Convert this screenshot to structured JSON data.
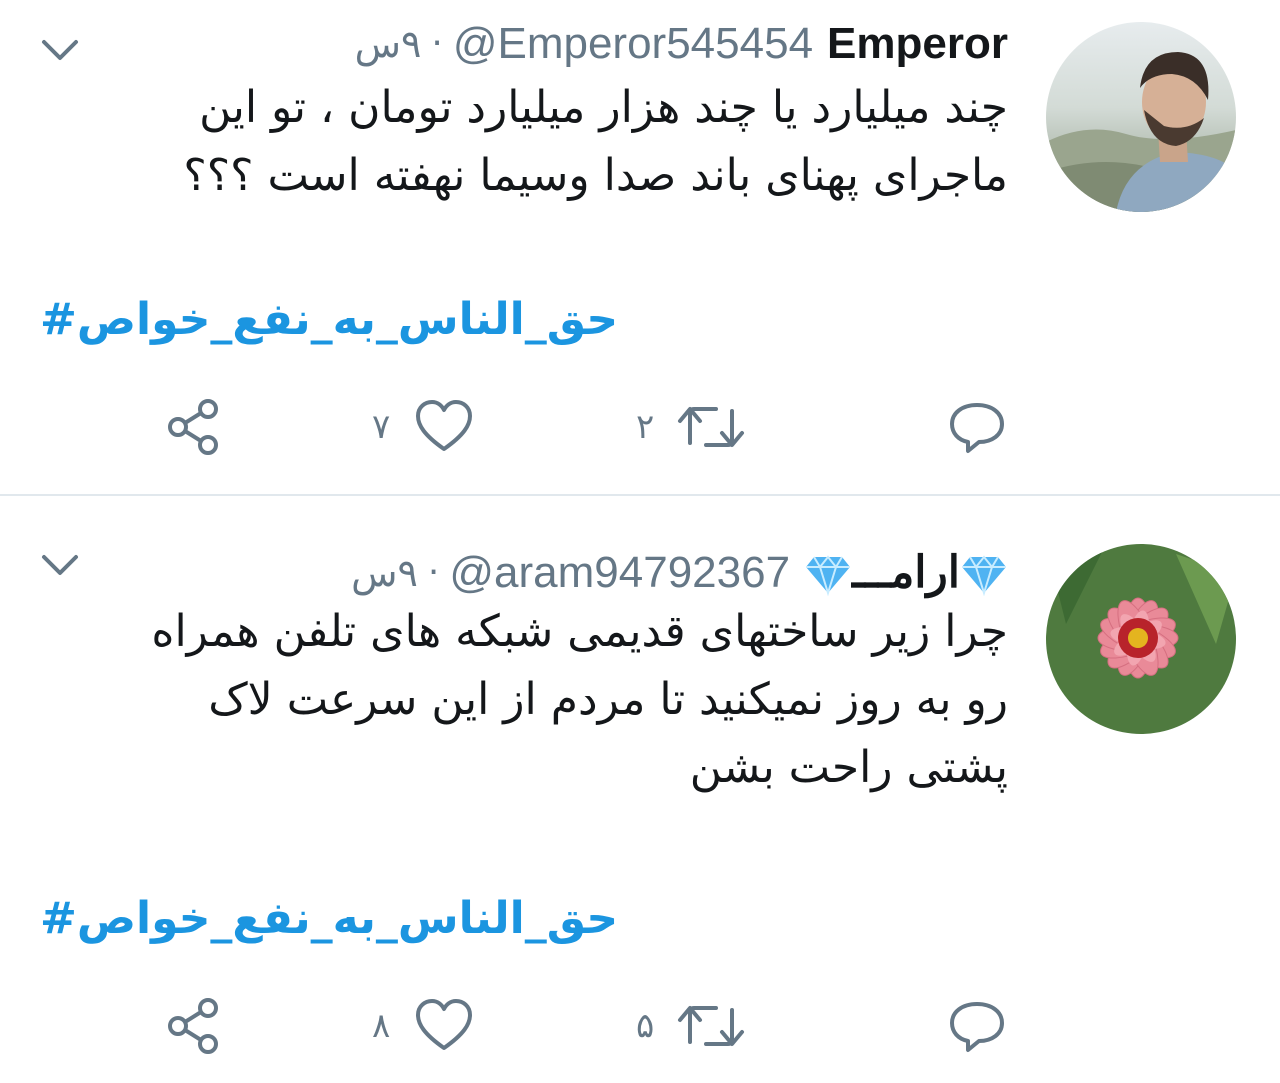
{
  "tweets": [
    {
      "display_name": "Emperor",
      "handle": "@Emperor545454",
      "separator": "·",
      "time": "۹س",
      "text": "چند میلیارد یا چند هزار میلیارد تومان ، تو این ماجرای پهنای باند صدا وسیما نهفته است ؟؟؟",
      "hashtag": "حق_الناس_به_نفع_خواص#",
      "retweets": "۲",
      "likes": "۷",
      "avatar": "profile-photo-man"
    },
    {
      "display_name": "ارامـــ",
      "handle": "@aram94792367",
      "separator": "·",
      "time": "۹س",
      "text": "چرا زیر ساختهای قدیمی شبکه های تلفن همراه رو به روز نمیکنید تا مردم از این سرعت لاک پشتی راحت بشن",
      "hashtag": "حق_الناس_به_نفع_خواص#",
      "retweets": "۵",
      "likes": "۸",
      "avatar": "profile-photo-pink-flower"
    }
  ],
  "colors": {
    "link": "#1b95e0",
    "secondary_text": "#657786",
    "icon": "#657786",
    "divider": "#e1e8ed",
    "gem": "#4fb3f2"
  },
  "icons": [
    "chevron-down-icon",
    "reply-icon",
    "retweet-icon",
    "like-icon",
    "share-icon",
    "diamond-icon"
  ]
}
